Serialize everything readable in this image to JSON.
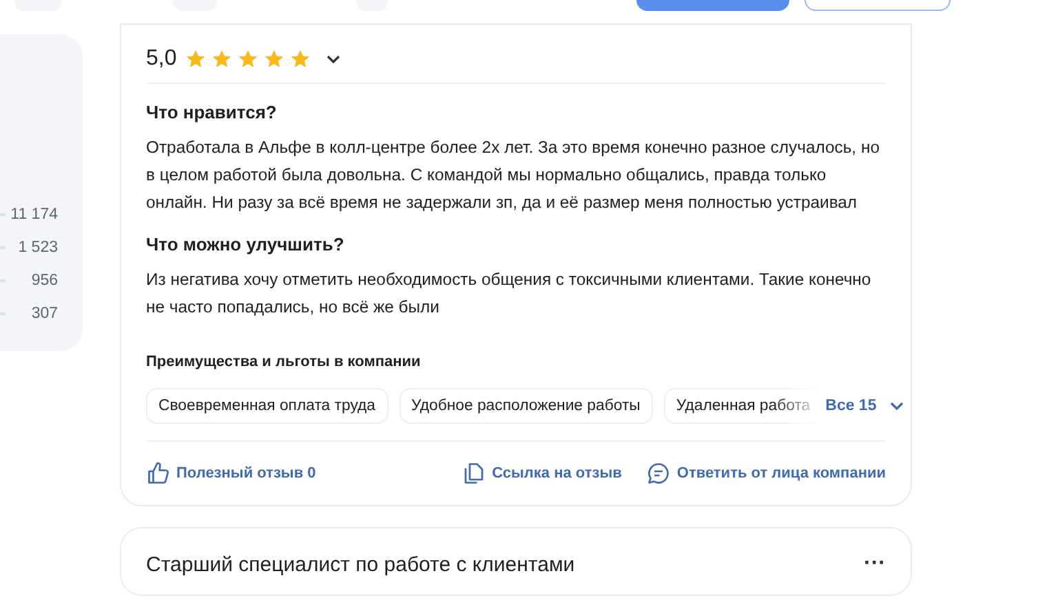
{
  "left_panel": {
    "counts": [
      "11 174",
      "1 523",
      "956",
      "307"
    ]
  },
  "review": {
    "rating": "5,0",
    "stars": 5,
    "sections": [
      {
        "heading": "Что нравится?",
        "text": "Отработала в Альфе в колл-центре более 2х лет. За это время конечно разное случалось, но в целом работой была довольна. С командой мы нормально общались, правда только онлайн. Ни разу за всё время не задержали зп, да и её размер меня полностью устраивал"
      },
      {
        "heading": "Что можно улучшить?",
        "text": "Из негатива хочу отметить необходимость общения с токсичными клиентами. Такие конечно не часто попадались, но всё же были"
      }
    ],
    "benefits": {
      "heading": "Преимущества и льготы в компании",
      "tags": [
        "Своевременная оплата труда",
        "Удобное расположение работы",
        "Удаленная работа"
      ],
      "more": "Все 15"
    },
    "actions": {
      "helpful": "Полезный отзыв 0",
      "link": "Ссылка на отзыв",
      "reply": "Ответить от лица компании"
    }
  },
  "next_review": {
    "title": "Старший специалист по работе с клиентами",
    "menu": "···"
  }
}
